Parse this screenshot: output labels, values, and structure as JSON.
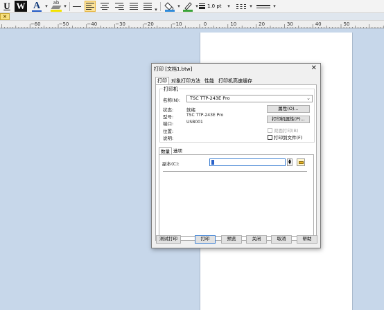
{
  "toolbar": {
    "underline_label": "U",
    "w_label": "W",
    "font_color_label": "A",
    "highlight_label": "ab",
    "dropdown_glyph": "▾",
    "line_weight": "1.0 pt",
    "colors": {
      "highlight": "#f2e200",
      "font": "#1d56c4",
      "active": "#fbe29a"
    }
  },
  "ruler": {
    "labels": [
      "−60",
      "−50",
      "−40",
      "−30",
      "−20",
      "−10",
      "0",
      "10",
      "20",
      "30",
      "40",
      "50"
    ],
    "close_mark": "×"
  },
  "dialog": {
    "title": "打印 [文档1.btw]",
    "close_glyph": "✕",
    "tabs": [
      "打印",
      "对象打印方法",
      "性能",
      "打印机高速缓存"
    ],
    "printer_group": {
      "legend": "打印机",
      "name_label": "名称(N):",
      "name_value": "TSC TTP-243E Pro",
      "status_label": "状态:",
      "status_value": "就绪",
      "model_label": "型号:",
      "model_value": "TSC TTP-243E Pro",
      "port_label": "端口:",
      "port_value": "USB001",
      "location_label": "位置:",
      "location_value": "",
      "comment_label": "说明:",
      "comment_value": "",
      "properties_button": "属性(O)...",
      "printer_properties_button": "打印机属性(P)...",
      "duplex_checkbox": "双面打印(B)",
      "print_to_file_checkbox": "打印到文件(F)"
    },
    "subtabs": [
      "数量",
      "选项"
    ],
    "copies": {
      "label": "副本(C):",
      "value": "1"
    },
    "footer": {
      "test_print": "测试打印",
      "print": "打印",
      "preview": "预览",
      "close": "关闭",
      "cancel": "取消",
      "help": "帮助"
    }
  }
}
